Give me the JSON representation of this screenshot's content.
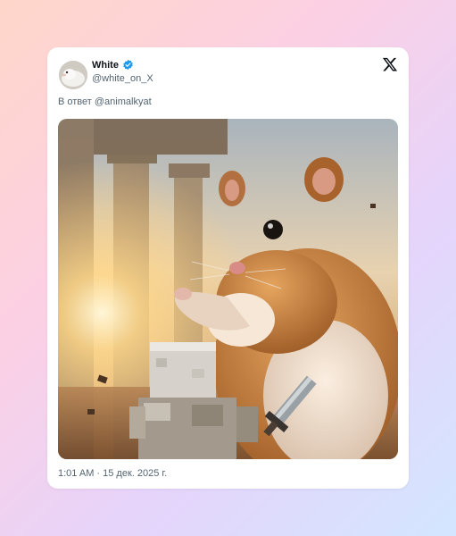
{
  "tweet": {
    "author_name": "White",
    "author_handle": "@white_on_X",
    "reply_prefix": "В ответ",
    "reply_mention": "@animalkyat",
    "timestamp": "1:01 AM · 15 дек. 2025 г.",
    "verified_icon": "verified-badge-icon",
    "brand_icon": "x-logo-icon",
    "media_subject": "hamster-and-blocky-knight-image"
  },
  "colors": {
    "verified": "#1d9bf0",
    "text_primary": "#0f1419",
    "text_secondary": "#536471",
    "card_bg": "#ffffff"
  }
}
